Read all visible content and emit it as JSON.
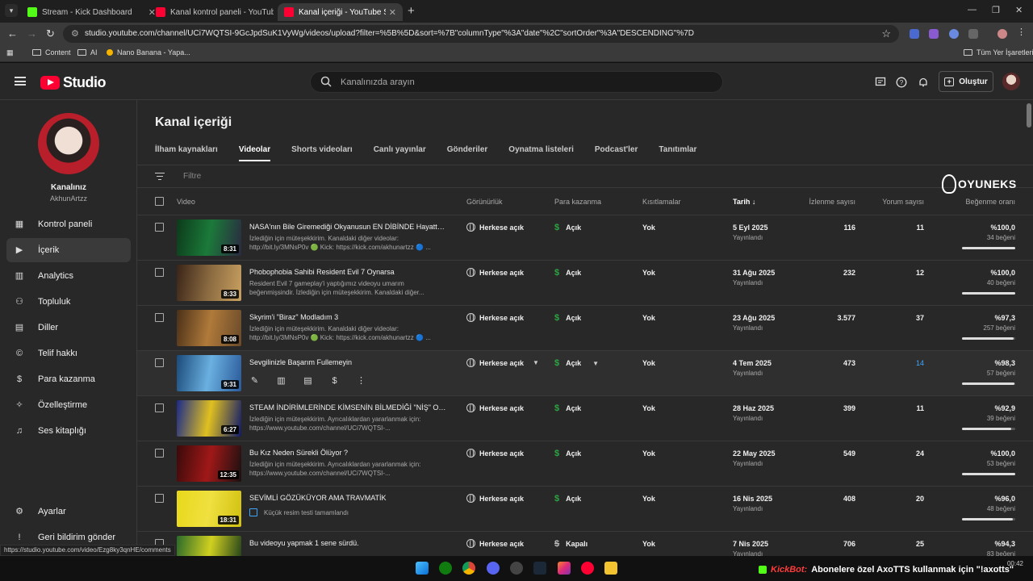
{
  "browser": {
    "tabs": [
      {
        "title": "Stream - Kick Dashboard",
        "icon": "kick-icon"
      },
      {
        "title": "Kanal kontrol paneli - YouTube",
        "icon": "youtube-icon"
      },
      {
        "title": "Kanal içeriği - YouTube Studio",
        "icon": "youtube-icon",
        "active": true
      }
    ],
    "url": "studio.youtube.com/channel/UCi7WQTSI-9GcJpdSuK1VyWg/videos/upload?filter=%5B%5D&sort=%7B\"columnType\"%3A\"date\"%2C\"sortOrder\"%3A\"DESCENDING\"%7D",
    "bookmarks": [
      "Content",
      "AI",
      "Nano Banana - Yapa...",
      "Tüm Yer İşaretleri"
    ]
  },
  "studio": {
    "logo": "Studio",
    "search_placeholder": "Kanalınızda arayın",
    "create_label": "Oluştur",
    "channel_name": "Kanalınız",
    "channel_handle": "AkhunArtzz"
  },
  "sidebar": {
    "items": [
      {
        "label": "Kontrol paneli",
        "icon": "dashboard-icon"
      },
      {
        "label": "İçerik",
        "icon": "content-icon",
        "active": true
      },
      {
        "label": "Analytics",
        "icon": "analytics-icon"
      },
      {
        "label": "Topluluk",
        "icon": "community-icon"
      },
      {
        "label": "Diller",
        "icon": "subtitles-icon"
      },
      {
        "label": "Telif hakkı",
        "icon": "copyright-icon"
      },
      {
        "label": "Para kazanma",
        "icon": "dollar-icon"
      },
      {
        "label": "Özelleştirme",
        "icon": "magic-wand-icon"
      },
      {
        "label": "Ses kitaplığı",
        "icon": "audio-library-icon"
      }
    ],
    "bottom": [
      {
        "label": "Ayarlar",
        "icon": "gear-icon"
      },
      {
        "label": "Geri bildirim gönder",
        "icon": "feedback-icon"
      }
    ]
  },
  "main": {
    "title": "Kanal içeriği",
    "tabs": [
      "İlham kaynakları",
      "Videolar",
      "Shorts videoları",
      "Canlı yayınlar",
      "Gönderiler",
      "Oynatma listeleri",
      "Podcast'ler",
      "Tanıtımlar"
    ],
    "active_tab": "Videolar",
    "filter_placeholder": "Filtre",
    "columns": {
      "video": "Video",
      "visibility": "Görünürlük",
      "monetization": "Para kazanma",
      "restrictions": "Kısıtlamalar",
      "date": "Tarih",
      "views": "İzlenme sayısı",
      "comments": "Yorum sayısı",
      "likes": "Beğenme oranı"
    },
    "rows": [
      {
        "title": "NASA'nın Bile Giremediği Okyanusun EN DİBİNDE Hayatta Kal...",
        "desc": "İzlediğin için müteşekkirim. Kanaldaki diğer videolar: http://bit.ly/3MNsP0v 🟢 Kick: https://kick.com/akhunartzz 🔵 ...",
        "duration": "8:31",
        "visibility": "Herkese açık",
        "monetization": "Açık",
        "restrictions": "Yok",
        "date": "5 Eyl 2025",
        "date_status": "Yayınlandı",
        "views": "116",
        "comments": "11",
        "like_pct": "%100,0",
        "likes": "34 beğeni",
        "like_ratio": 1.0,
        "thumb": [
          "#0c3a1a",
          "#1b7a3a",
          "#2a2a40"
        ]
      },
      {
        "title": "Phobophobia Sahibi Resident Evil 7 Oynarsa",
        "desc": "Resident Evil 7 gameplay'i yaptığımız videoyu umarım beğenmişsindir. İzlediğin için müteşekkirim. Kanaldaki diğer...",
        "duration": "8:33",
        "visibility": "Herkese açık",
        "monetization": "Açık",
        "restrictions": "Yok",
        "date": "31 Ağu 2025",
        "date_status": "Yayınlandı",
        "views": "232",
        "comments": "12",
        "like_pct": "%100,0",
        "likes": "40 beğeni",
        "like_ratio": 1.0,
        "thumb": [
          "#3a2418",
          "#8a6a40",
          "#c9a060"
        ]
      },
      {
        "title": "Skyrim'i \"Biraz\" Modladım 3",
        "desc": "İzlediğin için müteşekkirim. Kanaldaki diğer videolar: http://bit.ly/3MNsP0v 🟢 Kick: https://kick.com/akhunartzz 🔵 ...",
        "duration": "8:08",
        "visibility": "Herkese açık",
        "monetization": "Açık",
        "restrictions": "Yok",
        "date": "23 Ağu 2025",
        "date_status": "Yayınlandı",
        "views": "3.577",
        "comments": "37",
        "like_pct": "%97,3",
        "likes": "257 beğeni",
        "like_ratio": 0.973,
        "thumb": [
          "#4a3018",
          "#b07a3a",
          "#6a4a2a"
        ]
      },
      {
        "title": "Sevgilinizle Başarım Fullemeyin",
        "duration": "9:31",
        "visibility": "Herkese açık",
        "monetization": "Açık",
        "restrictions": "Yok",
        "date": "4 Tem 2025",
        "date_status": "Yayınlandı",
        "views": "473",
        "comments": "14",
        "like_pct": "%98,3",
        "likes": "57 beğeni",
        "like_ratio": 0.983,
        "hover": true,
        "thumb": [
          "#1a4a7a",
          "#6ab0e0",
          "#2a5a9a"
        ]
      },
      {
        "title": "STEAM İNDİRİMLERİNDE KİMSENİN BİLMEDİĞİ \"NİŞ\" OYUNL...",
        "desc": "İzlediğin için müteşekkirim. Ayrıcalıklardan yararlanmak için: https://www.youtube.com/channel/UCi7WQTSI-...",
        "duration": "6:27",
        "visibility": "Herkese açık",
        "monetization": "Açık",
        "restrictions": "Yok",
        "date": "28 Haz 2025",
        "date_status": "Yayınlandı",
        "views": "399",
        "comments": "11",
        "like_pct": "%92,9",
        "likes": "39 beğeni",
        "like_ratio": 0.929,
        "thumb": [
          "#1a2a8a",
          "#e0c020",
          "#101a6a"
        ]
      },
      {
        "title": "Bu Kız Neden Sürekli Ölüyor ?",
        "desc": "İzlediğin için müteşekkirim. Ayrıcalıklardan yararlanmak için: https://www.youtube.com/channel/UCi7WQTSI-...",
        "duration": "12:35",
        "visibility": "Herkese açık",
        "monetization": "Açık",
        "restrictions": "Yok",
        "date": "22 May 2025",
        "date_status": "Yayınlandı",
        "views": "549",
        "comments": "24",
        "like_pct": "%100,0",
        "likes": "53 beğeni",
        "like_ratio": 1.0,
        "thumb": [
          "#3a0a0a",
          "#a01818",
          "#1a1010"
        ]
      },
      {
        "title": "SEVİMLİ GÖZÜKÜYOR AMA TRAVMATİK",
        "note": "Küçük resim testi tamamlandı",
        "duration": "18:31",
        "visibility": "Herkese açık",
        "monetization": "Açık",
        "restrictions": "Yok",
        "date": "16 Nis 2025",
        "date_status": "Yayınlandı",
        "views": "408",
        "comments": "20",
        "like_pct": "%96,0",
        "likes": "48 beğeni",
        "like_ratio": 0.96,
        "thumb": [
          "#e8d81a",
          "#f0e040",
          "#d0c010"
        ]
      },
      {
        "title": "Bu videoyu yapmak 1 sene sürdü.",
        "duration": "",
        "visibility": "Herkese açık",
        "monetization": "Kapalı",
        "restrictions": "Yok",
        "date": "7 Nis 2025",
        "date_status": "Yayınlandı",
        "views": "706",
        "comments": "25",
        "like_pct": "%94,3",
        "likes": "83 beğeni",
        "like_ratio": 0.943,
        "monetization_off": true,
        "thumb": [
          "#2a6a2a",
          "#d0d020",
          "#1a3a1a"
        ]
      }
    ]
  },
  "watermark": "OYUNEKS",
  "status_url": "https://studio.youtube.com/video/Ezg8ky3qnHE/comments",
  "overlay": {
    "bot": "KickBot:",
    "message": "Abonelere özel AxoTTS kullanmak için \"!axotts\""
  },
  "clock": "00:42"
}
